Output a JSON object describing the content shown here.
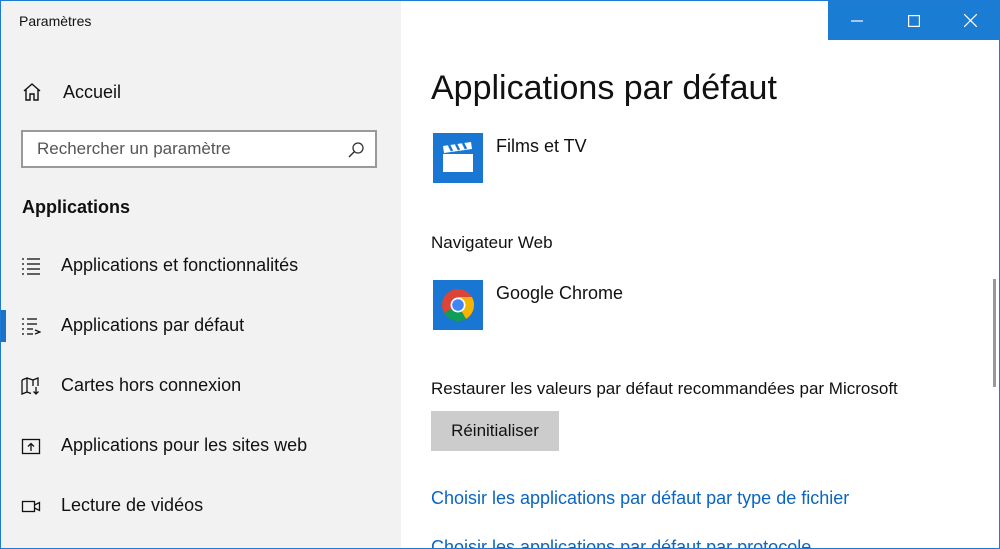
{
  "window": {
    "title": "Paramètres"
  },
  "sidebar": {
    "home_label": "Accueil",
    "search_placeholder": "Rechercher un paramètre",
    "section_title": "Applications",
    "items": [
      {
        "label": "Applications et fonctionnalités",
        "icon": "list-icon",
        "selected": false
      },
      {
        "label": "Applications par défaut",
        "icon": "default-apps-icon",
        "selected": true
      },
      {
        "label": "Cartes hors connexion",
        "icon": "map-download-icon",
        "selected": false
      },
      {
        "label": "Applications pour les sites web",
        "icon": "open-in-app-icon",
        "selected": false
      },
      {
        "label": "Lecture de vidéos",
        "icon": "video-camera-icon",
        "selected": false
      }
    ]
  },
  "main": {
    "page_title": "Applications par défaut",
    "video_player": {
      "app_name": "Films et TV",
      "icon": "clapperboard-icon"
    },
    "web_browser": {
      "label": "Navigateur Web",
      "app_name": "Google Chrome",
      "icon": "chrome-icon"
    },
    "reset": {
      "label": "Restaurer les valeurs par défaut recommandées par Microsoft",
      "button_label": "Réinitialiser"
    },
    "links": [
      "Choisir les applications par défaut par type de fichier",
      "Choisir les applications par défaut par protocole"
    ]
  },
  "colors": {
    "accent": "#1a7cd3",
    "sidebar_bg": "#f2f2f2",
    "link": "#0a66c2",
    "button_bg": "#cccccc",
    "tile_blue": "#1976d2"
  }
}
